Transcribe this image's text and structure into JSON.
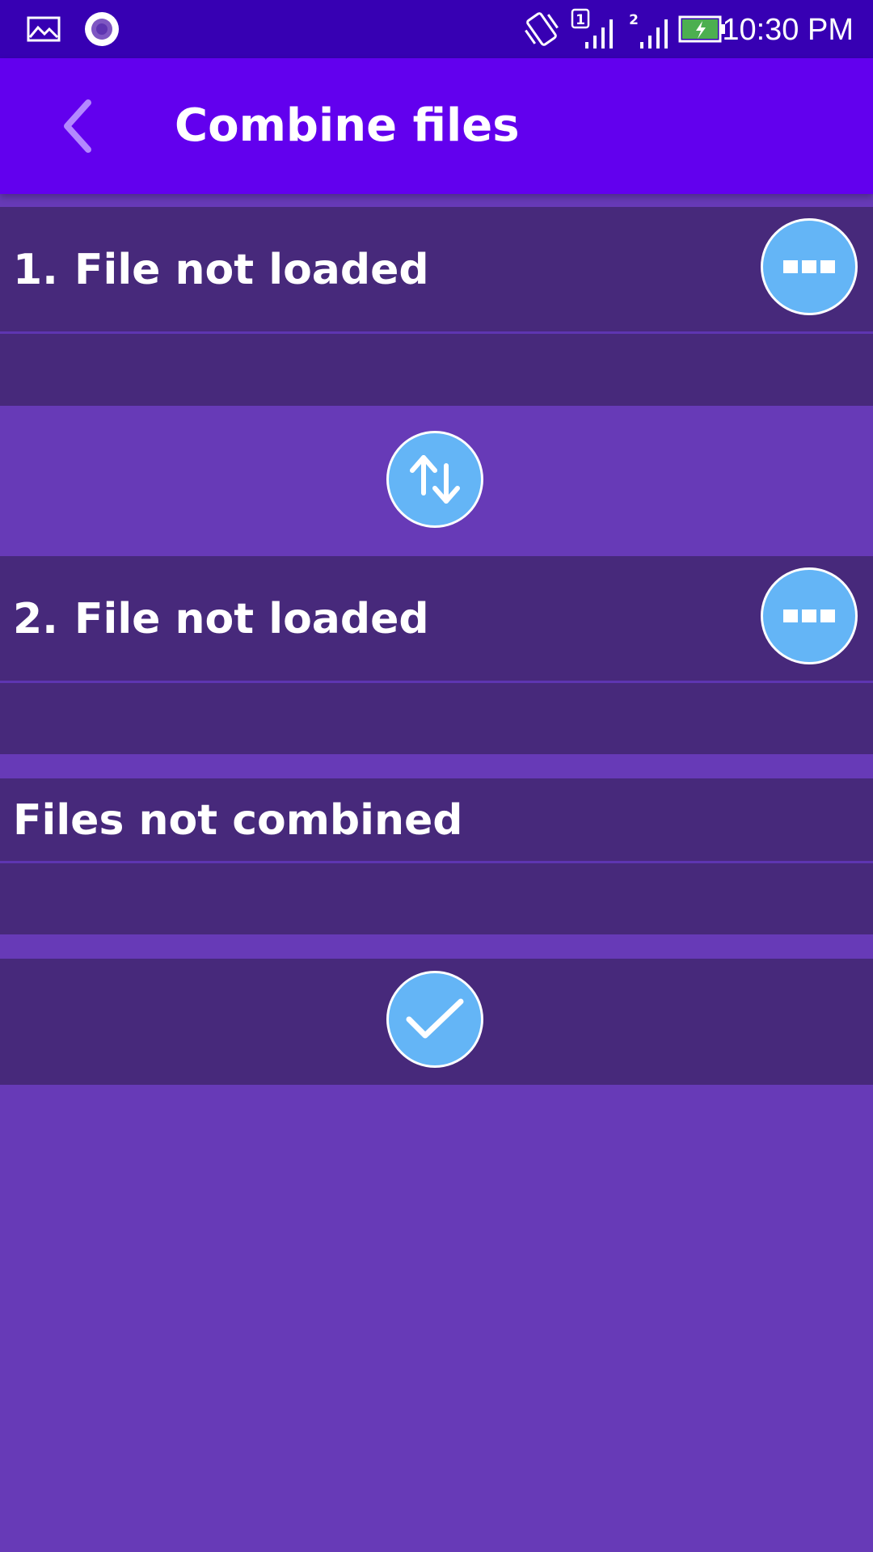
{
  "status_bar": {
    "time": "10:30 PM",
    "icons": [
      "image-icon",
      "record-icon",
      "vibrate-icon",
      "sim1-signal-icon",
      "sim2-signal-icon",
      "battery-charging-icon"
    ],
    "sim1_label": "1",
    "sim2_label": "2"
  },
  "app_bar": {
    "title": "Combine files",
    "back_icon": "chevron-left-icon"
  },
  "files": [
    {
      "number": "1.",
      "status": "File not loaded",
      "menu_icon": "more-icon"
    },
    {
      "number": "2.",
      "status": "File not loaded",
      "menu_icon": "more-icon"
    }
  ],
  "swap_button": {
    "icon": "swap-vertical-icon"
  },
  "result": {
    "status": "Files not combined"
  },
  "confirm_button": {
    "icon": "checkmark-icon"
  },
  "colors": {
    "status_bar": "#3700B3",
    "app_bar": "#6200EE",
    "background": "#673AB7",
    "block": "#47297B",
    "accent_button": "#64B5F6"
  }
}
